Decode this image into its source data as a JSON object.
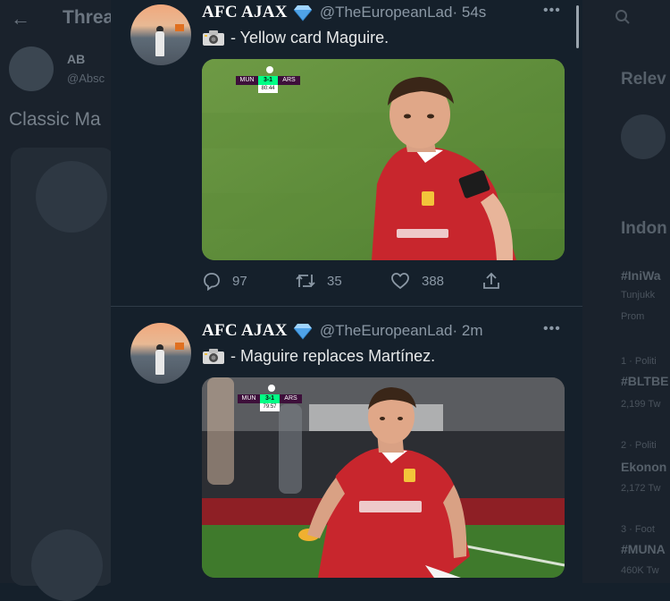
{
  "background_left": {
    "title": "Threa",
    "user_initials": "AB",
    "user_handle": "@Absc",
    "tweet_text": "Classic Ma"
  },
  "background_right": {
    "section_relevant": "Relev",
    "section_trends": "Indon",
    "trend1_tag": "#IniWa",
    "trend1_sub": "Tunjukk",
    "trend1_promo": "Prom",
    "trend2_meta": "1 · Politi",
    "trend2_tag": "#BLTBE",
    "trend2_count": "2,199 Tw",
    "trend3_meta": "2 · Politi",
    "trend3_tag": "Ekonon",
    "trend3_count": "2,172 Tw",
    "trend4_meta": "3 · Foot",
    "trend4_tag": "#MUNA",
    "trend4_count": "460K Tw"
  },
  "tweets": [
    {
      "display_name": "AFC AJAX",
      "handle": "@TheEuropeanLad",
      "time": "· 54s",
      "text": "- Yellow card Maguire.",
      "scoreboard": {
        "home": "MUN",
        "score": "3-1",
        "away": "ARS",
        "clock": "80:44"
      },
      "actions": {
        "replies": "97",
        "retweets": "35",
        "likes": "388"
      }
    },
    {
      "display_name": "AFC AJAX",
      "handle": "@TheEuropeanLad",
      "time": "· 2m",
      "text": "- Maguire replaces Martínez.",
      "scoreboard": {
        "home": "MUN",
        "score": "3-1",
        "away": "ARS",
        "clock": "79:57"
      }
    }
  ],
  "icons": {
    "verified": "diamond-icon",
    "camera": "camera-icon",
    "reply": "reply-icon",
    "retweet": "retweet-icon",
    "like": "heart-icon",
    "share": "share-icon"
  },
  "colors": {
    "background": "#15202b",
    "verified": "#4fa3e8",
    "muted": "#8b98a5",
    "shirt_red": "#c8262d"
  }
}
